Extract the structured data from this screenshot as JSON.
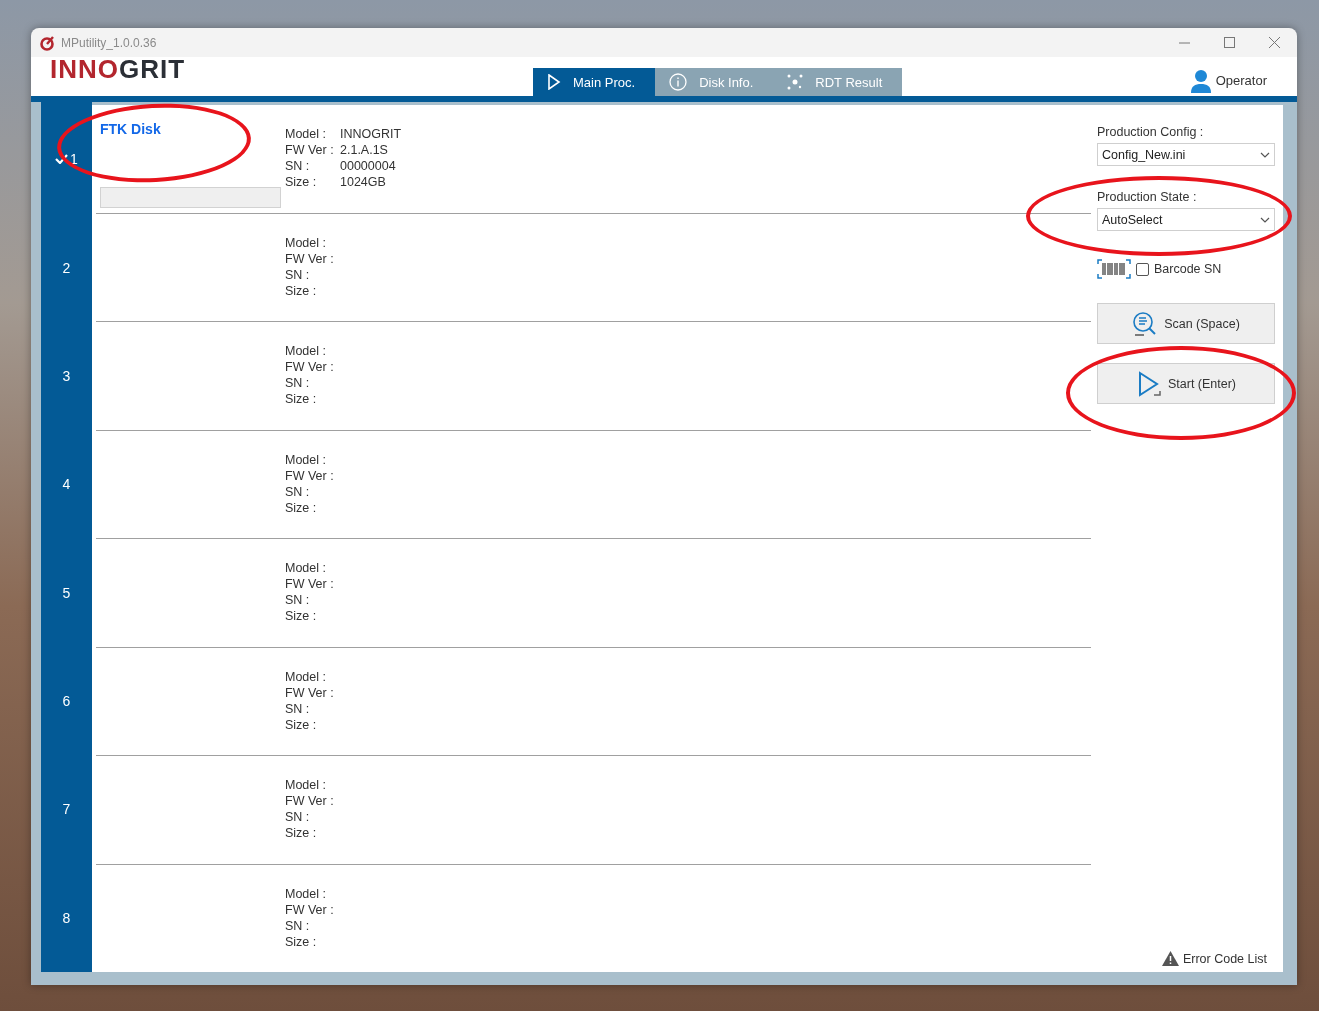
{
  "window": {
    "title": "MPutility_1.0.0.36"
  },
  "logo": [
    "INNO",
    "GRIT"
  ],
  "tabs": [
    {
      "label": "Main Proc.",
      "selected": true
    },
    {
      "label": "Disk Info.",
      "selected": false
    },
    {
      "label": "RDT Result",
      "selected": false
    }
  ],
  "user": {
    "label": "Operator"
  },
  "slots": [
    {
      "number": "1",
      "checked": true,
      "name": "FTK Disk",
      "progress_bar": true,
      "fields": [
        {
          "label": "Model :",
          "value": "INNOGRIT"
        },
        {
          "label": "FW Ver :",
          "value": "2.1.A.1S"
        },
        {
          "label": "SN :",
          "value": "00000004"
        },
        {
          "label": "Size :",
          "value": "1024GB"
        }
      ]
    },
    {
      "number": "2",
      "checked": false,
      "fields": [
        {
          "label": "Model :"
        },
        {
          "label": "FW Ver :"
        },
        {
          "label": "SN :"
        },
        {
          "label": "Size :"
        }
      ]
    },
    {
      "number": "3",
      "checked": false,
      "fields": [
        {
          "label": "Model :"
        },
        {
          "label": "FW Ver :"
        },
        {
          "label": "SN :"
        },
        {
          "label": "Size :"
        }
      ]
    },
    {
      "number": "4",
      "checked": false,
      "fields": [
        {
          "label": "Model :"
        },
        {
          "label": "FW Ver :"
        },
        {
          "label": "SN :"
        },
        {
          "label": "Size :"
        }
      ]
    },
    {
      "number": "5",
      "checked": false,
      "fields": [
        {
          "label": "Model :"
        },
        {
          "label": "FW Ver :"
        },
        {
          "label": "SN :"
        },
        {
          "label": "Size :"
        }
      ]
    },
    {
      "number": "6",
      "checked": false,
      "fields": [
        {
          "label": "Model :"
        },
        {
          "label": "FW Ver :"
        },
        {
          "label": "SN :"
        },
        {
          "label": "Size :"
        }
      ]
    },
    {
      "number": "7",
      "checked": false,
      "fields": [
        {
          "label": "Model :"
        },
        {
          "label": "FW Ver :"
        },
        {
          "label": "SN :"
        },
        {
          "label": "Size :"
        }
      ]
    },
    {
      "number": "8",
      "checked": false,
      "fields": [
        {
          "label": "Model :"
        },
        {
          "label": "FW Ver :"
        },
        {
          "label": "SN :"
        },
        {
          "label": "Size :"
        }
      ]
    }
  ],
  "production_config": {
    "label": "Production Config :",
    "value": "Config_New.ini"
  },
  "production_state": {
    "label": "Production State :",
    "value": "AutoSelect"
  },
  "barcode_sn": {
    "label": "Barcode SN",
    "checked": false
  },
  "buttons": [
    {
      "label": "Scan (Space)",
      "kind": "scan"
    },
    {
      "label": "Start (Enter)",
      "kind": "start"
    }
  ],
  "error_code_list": {
    "label": "Error Code List"
  }
}
